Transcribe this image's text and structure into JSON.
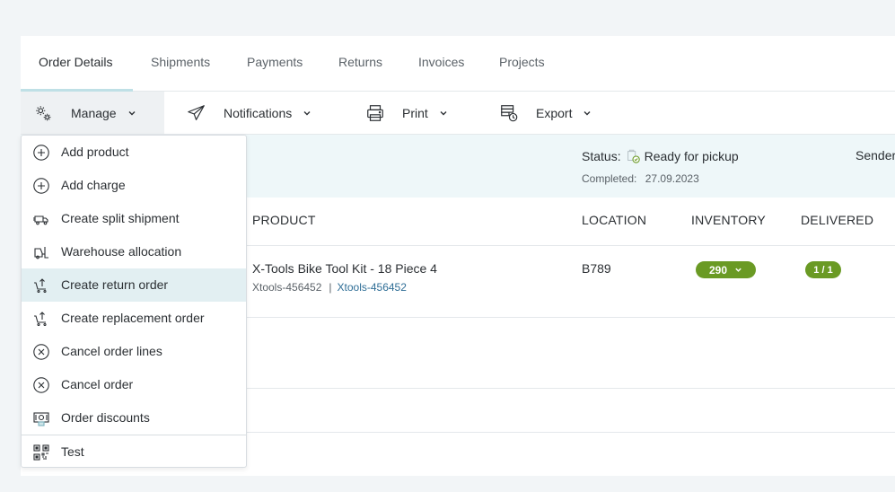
{
  "tabs": [
    {
      "label": "Order Details"
    },
    {
      "label": "Shipments"
    },
    {
      "label": "Payments"
    },
    {
      "label": "Returns"
    },
    {
      "label": "Invoices"
    },
    {
      "label": "Projects"
    }
  ],
  "toolbar": {
    "manage": "Manage",
    "notifications": "Notifications",
    "print": "Print",
    "export": "Export"
  },
  "status": {
    "label": "Status:",
    "value": "Ready for pickup",
    "completed_label": "Completed:",
    "completed_date": "27.09.2023",
    "sender_label": "Sender"
  },
  "table": {
    "headers": {
      "product": "PRODUCT",
      "location": "LOCATION",
      "inventory": "INVENTORY",
      "delivered": "DELIVERED"
    },
    "rows": [
      {
        "product_name": "X-Tools Bike Tool Kit - 18 Piece 4",
        "sku": "Xtools-456452",
        "sku_link": "Xtools-456452",
        "location": "B789",
        "inventory": "290",
        "delivered": "1 / 1"
      }
    ]
  },
  "menu": {
    "items": [
      {
        "label": "Add product",
        "icon": "plus-circle-icon"
      },
      {
        "label": "Add charge",
        "icon": "plus-circle-icon"
      },
      {
        "label": "Create split shipment",
        "icon": "truck-icon"
      },
      {
        "label": "Warehouse allocation",
        "icon": "forklift-icon"
      },
      {
        "label": "Create return order",
        "icon": "cart-return-icon"
      },
      {
        "label": "Create replacement order",
        "icon": "cart-replace-icon"
      },
      {
        "label": "Cancel order lines",
        "icon": "x-circle-icon"
      },
      {
        "label": "Cancel order",
        "icon": "x-circle-icon"
      },
      {
        "label": "Order discounts",
        "icon": "discount-icon"
      },
      {
        "label": "Test",
        "icon": "qr-code-icon"
      }
    ],
    "highlighted": "Create return order"
  },
  "colors": {
    "accent": "#bfe0e6",
    "status_green": "#6a9a24",
    "link": "#2f6e96",
    "menu_highlight": "#e2eff2"
  }
}
